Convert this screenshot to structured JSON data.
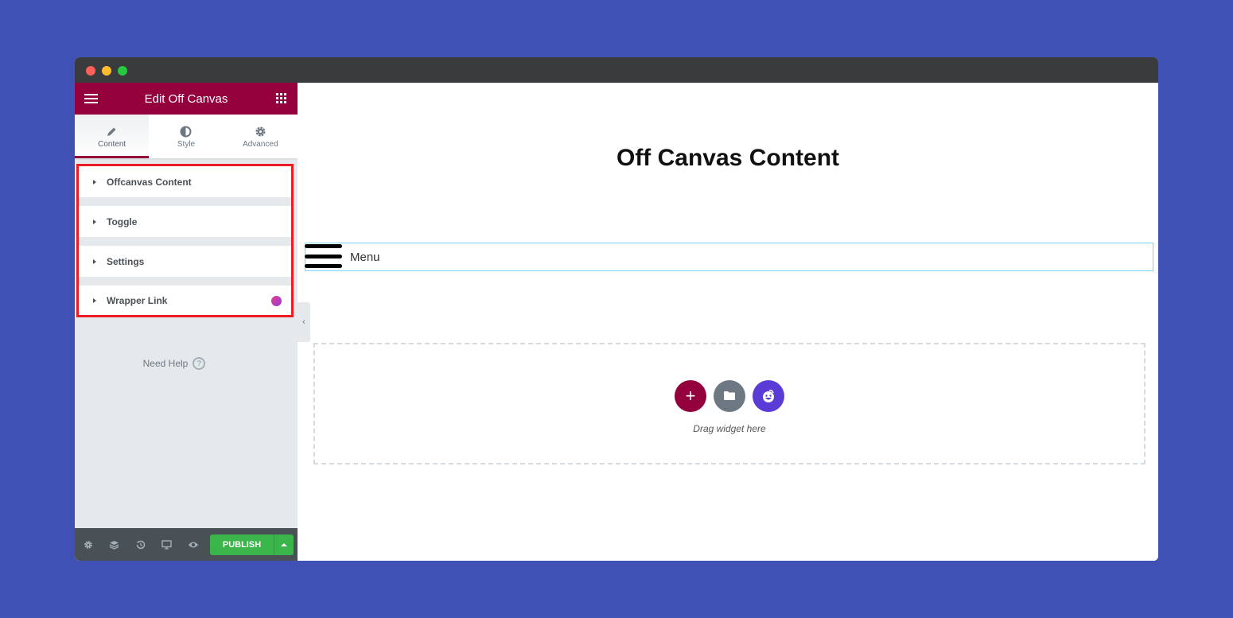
{
  "window": {
    "controls": [
      "close",
      "minimize",
      "maximize"
    ]
  },
  "panel": {
    "title": "Edit Off Canvas",
    "menu_icon": "hamburger-icon",
    "apps_icon": "grid-icon",
    "tabs": [
      {
        "label": "Content",
        "icon": "pencil-icon",
        "active": true
      },
      {
        "label": "Style",
        "icon": "half-circle-icon",
        "active": false
      },
      {
        "label": "Advanced",
        "icon": "gear-icon",
        "active": false
      }
    ],
    "sections": [
      {
        "label": "Offcanvas Content"
      },
      {
        "label": "Toggle"
      },
      {
        "label": "Settings"
      },
      {
        "label": "Wrapper Link",
        "badge": "elementskit-icon"
      }
    ],
    "need_help": "Need Help",
    "help_glyph": "?",
    "footer": {
      "icons": [
        "gear-icon",
        "layers-icon",
        "history-icon",
        "responsive-icon",
        "eye-icon"
      ],
      "publish_label": "PUBLISH"
    },
    "collapse_glyph": "‹"
  },
  "canvas": {
    "heading": "Off Canvas Content",
    "menu_label": "Menu",
    "dropzone_text": "Drag widget here",
    "add_glyph": "+"
  },
  "colors": {
    "brand": "#93003c",
    "publish": "#39b54a",
    "highlight": "#ed1c24",
    "background": "#3f51b5",
    "ekit": "#5b3bd6"
  }
}
